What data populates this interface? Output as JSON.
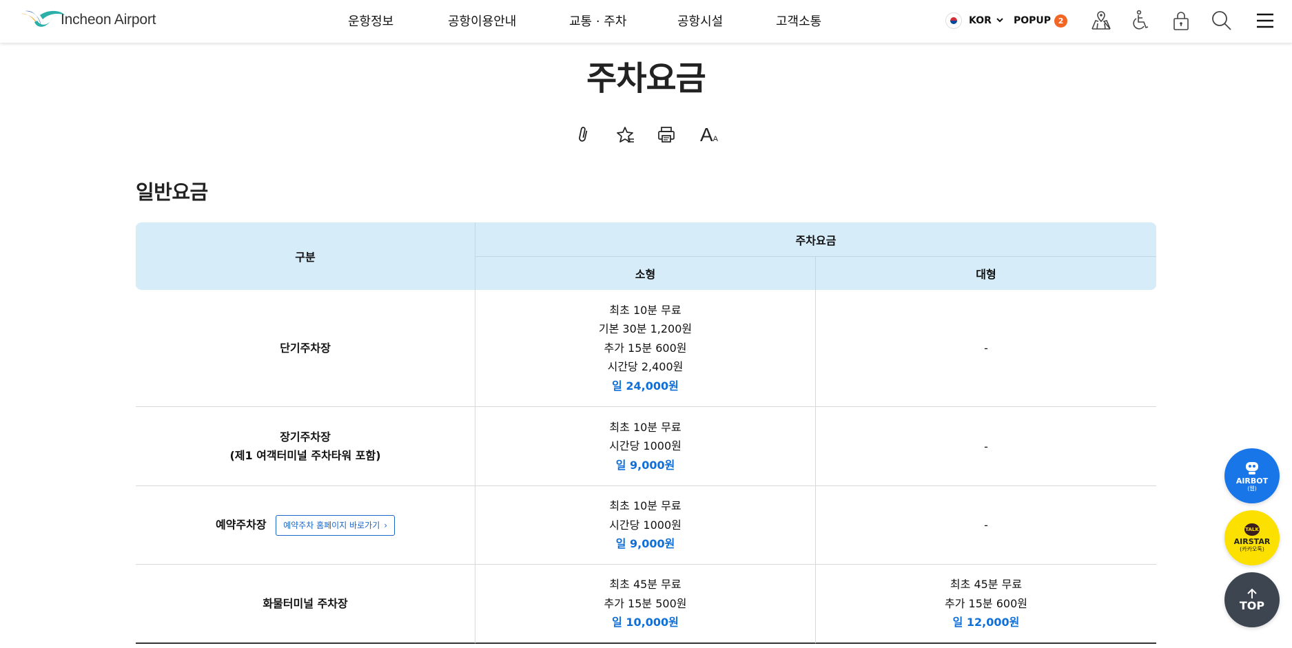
{
  "header": {
    "logo_text": "Incheon Airport",
    "nav": [
      "운항정보",
      "공항이용안내",
      "교통 · 주차",
      "공항시설",
      "고객소통"
    ],
    "lang_label": "KOR",
    "popup_label": "POPUP",
    "popup_count": "2",
    "icons": [
      "map-icon",
      "accessibility-icon",
      "lock-icon",
      "search-icon",
      "menu-icon"
    ]
  },
  "page": {
    "title": "주차요금",
    "tools": [
      "attachment-icon",
      "favorite-icon",
      "print-icon",
      "font-size-icon"
    ],
    "font_tool_big": "A",
    "font_tool_small": "A"
  },
  "section": {
    "title": "일반요금"
  },
  "table": {
    "header_category": "구분",
    "header_fee": "주차요금",
    "header_small": "소형",
    "header_large": "대형",
    "rows": [
      {
        "category": "단기주차장",
        "small": [
          "최초 10분 무료",
          "기본 30분 1,200원",
          "추가 15분 600원",
          "시간당 2,400원"
        ],
        "small_daily": "일 24,000원",
        "large": "-"
      },
      {
        "category_line1": "장기주차장",
        "category_line2": "(제1 여객터미널 주차타워 포함)",
        "small": [
          "최초 10분 무료",
          "시간당 1000원"
        ],
        "small_daily": "일 9,000원",
        "large": "-"
      },
      {
        "category": "예약주차장",
        "link_label": "예약주차 홈페이지 바로가기",
        "small": [
          "최초 10분 무료",
          "시간당 1000원"
        ],
        "small_daily": "일 9,000원",
        "large": "-"
      },
      {
        "category": "화물터미널 주차장",
        "small": [
          "최초 45분 무료",
          "추가 15분 500원"
        ],
        "small_daily": "일 10,000원",
        "large": [
          "최초 45분 무료",
          "추가 15분 600원"
        ],
        "large_daily": "일 12,000원"
      }
    ]
  },
  "floating": {
    "airbot_title": "AIRBOT",
    "airbot_sub": "(웹)",
    "airstar_badge": "TALK",
    "airstar_title": "AIRSTAR",
    "airstar_sub": "(카카오톡)",
    "top_label": "TOP"
  },
  "colors": {
    "accent_blue": "#0f6fd8",
    "table_header_bg": "#d6ecf9",
    "popup_badge": "#f26522",
    "airbot_bg": "#1976e8",
    "airstar_bg": "#fce000",
    "top_bg": "#3c4550"
  }
}
